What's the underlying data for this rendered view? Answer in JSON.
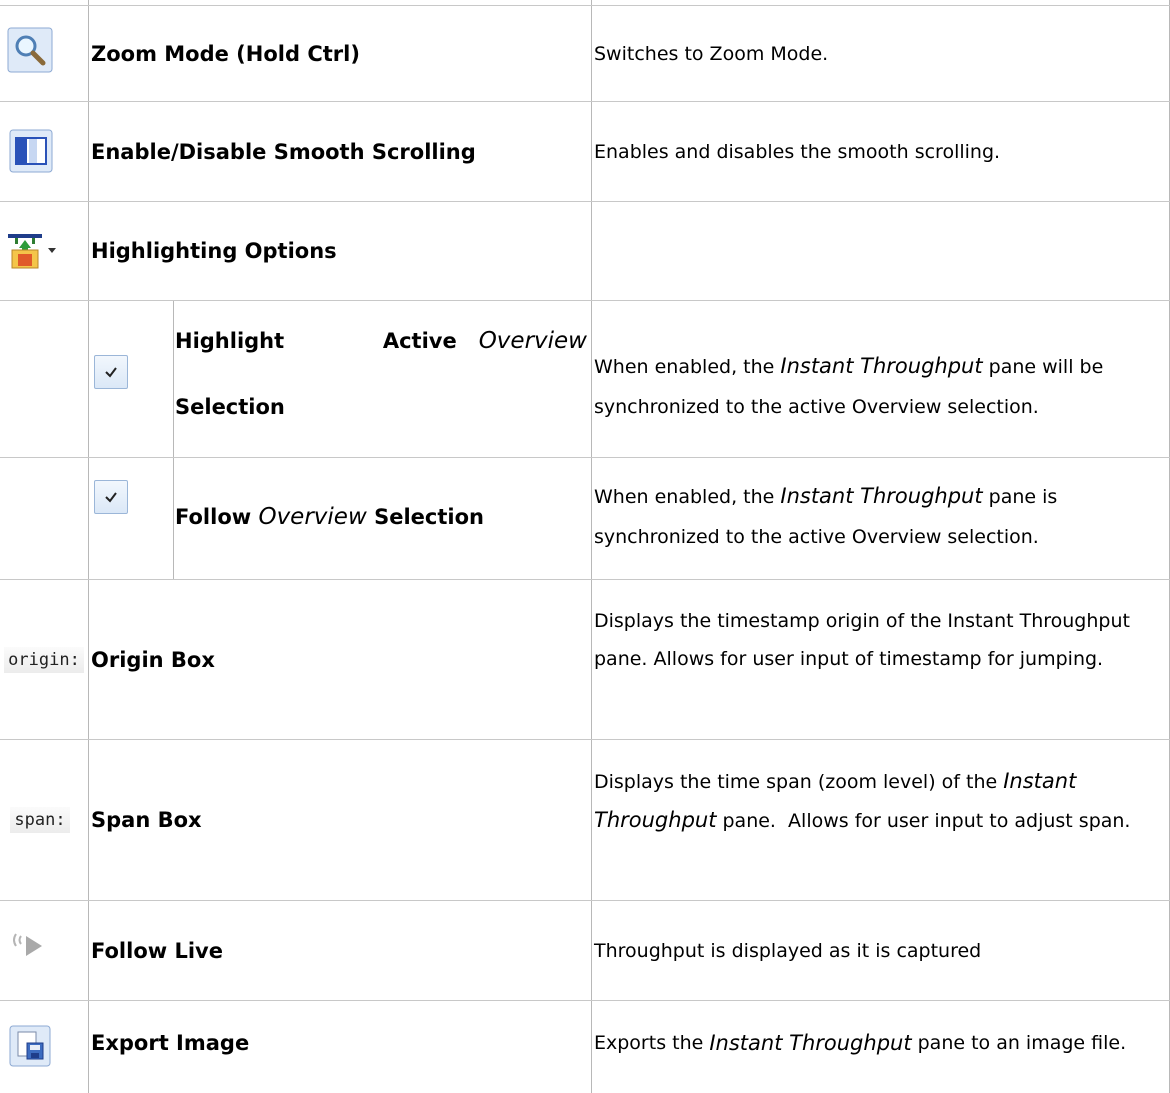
{
  "rows": [
    {
      "name": "Zoom Mode (Hold Ctrl)",
      "icon": "magnifier-icon",
      "desc": "Switches to Zoom Mode."
    },
    {
      "name": "Enable/Disable Smooth Scrolling",
      "icon": "smooth-scroll-icon",
      "desc": "Enables and disables the smooth scrolling."
    },
    {
      "name": "Highlighting Options",
      "icon": "highlighting-options-icon",
      "desc": ""
    },
    {
      "name_a": "Highlight",
      "name_b": "Active",
      "name_c": "Overview",
      "name_d": "Selection",
      "icon": "checkbox-icon",
      "desc_a": "When enabled, the ",
      "desc_b": "Instant Throughput",
      "desc_c": " pane will be synchronized to the active Overview selection."
    },
    {
      "name_a": "Follow ",
      "name_b": "Overview",
      "name_c": " Selection",
      "icon": "checkbox-icon",
      "desc_a": "When enabled, the ",
      "desc_b": "Instant Throughput",
      "desc_c": " pane is synchronized to the active Overview selection."
    },
    {
      "name": "Origin Box",
      "icon_text": "origin:",
      "desc": "Displays the timestamp origin of the Instant Throughput pane. Allows for user input of timestamp for jumping."
    },
    {
      "name": "Span Box",
      "icon_text": "span:",
      "desc_a": "Displays the time span (zoom level) of the ",
      "desc_b": "Instant Throughput",
      "desc_c": " pane.  Allows for user input to adjust span."
    },
    {
      "name": "Follow Live",
      "icon": "follow-live-icon",
      "desc": "Throughput is displayed as it is captured"
    },
    {
      "name": "Export Image",
      "icon": "export-image-icon",
      "desc_a": "Exports the ",
      "desc_b": "Instant Throughput",
      "desc_c": " pane to an image file."
    }
  ],
  "colors": {
    "grid": "#c8c8c8",
    "check_bg": "#dbe8f7",
    "check_border": "#9bb6d8"
  }
}
